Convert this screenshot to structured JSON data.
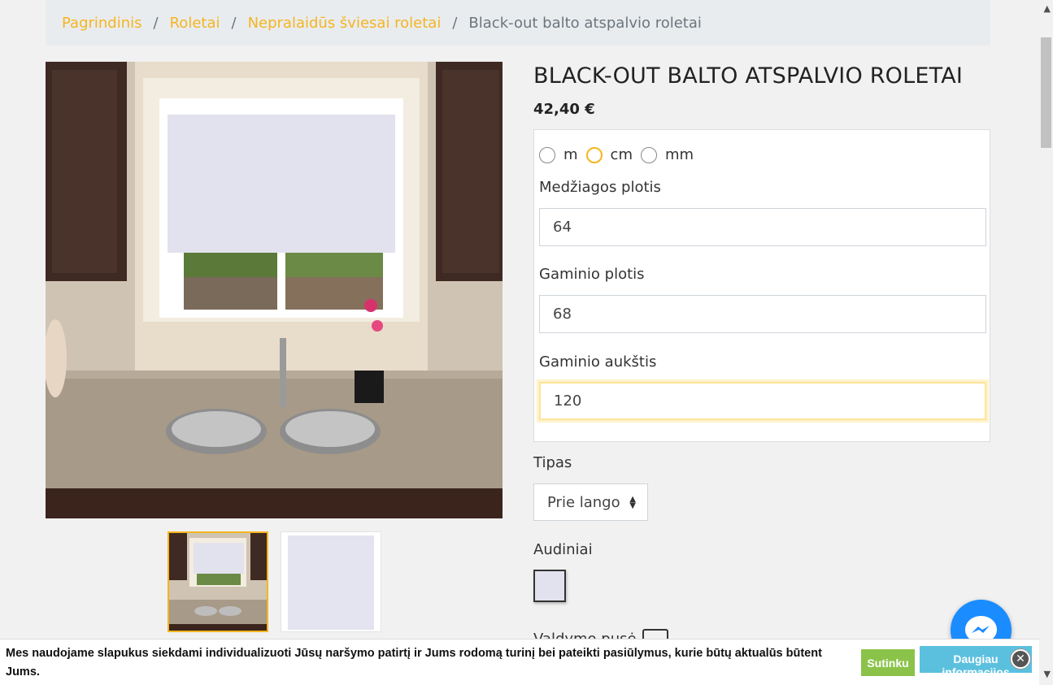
{
  "breadcrumb": {
    "items": [
      "Pagrindinis",
      "Roletai",
      "Nepralaidūs šviesai roletai"
    ],
    "active": "Black-out balto atspalvio roletai",
    "separator": "/"
  },
  "product": {
    "title": "BLACK-OUT BALTO ATSPALVIO ROLETAI",
    "price": "42,40 €"
  },
  "units": {
    "options": [
      "m",
      "cm",
      "mm"
    ],
    "selected": "cm"
  },
  "fields": {
    "fabric_width_label": "Medžiagos plotis",
    "fabric_width_value": "64",
    "product_width_label": "Gaminio plotis",
    "product_width_value": "68",
    "product_height_label": "Gaminio aukštis",
    "product_height_value": "120"
  },
  "type": {
    "label": "Tipas",
    "selected": "Prie lango"
  },
  "fabrics": {
    "label": "Audiniai",
    "swatch_color": "#e2e2ee"
  },
  "control": {
    "label": "Valdymo pusė"
  },
  "cookie": {
    "text": "Mes naudojame slapukus siekdami individualizuoti Jūsų naršymo patirtį ir Jums rodomą turinį bei pateikti pasiūlymus, kurie būtų aktualūs būtent Jums.",
    "accept_label": "Sutinku",
    "more_label": "Daugiau informacijos",
    "close_icon": "close-icon"
  },
  "colors": {
    "accent": "#f4b51f",
    "accept": "#8bc34a",
    "more": "#5bc0de",
    "messenger": "#1a8cff"
  }
}
